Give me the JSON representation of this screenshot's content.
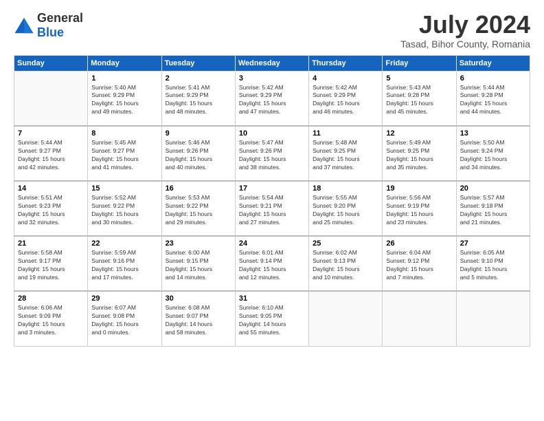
{
  "logo": {
    "general": "General",
    "blue": "Blue"
  },
  "title": {
    "month_year": "July 2024",
    "location": "Tasad, Bihor County, Romania"
  },
  "weekdays": [
    "Sunday",
    "Monday",
    "Tuesday",
    "Wednesday",
    "Thursday",
    "Friday",
    "Saturday"
  ],
  "weeks": [
    [
      {
        "day": "",
        "info": ""
      },
      {
        "day": "1",
        "info": "Sunrise: 5:40 AM\nSunset: 9:29 PM\nDaylight: 15 hours\nand 49 minutes."
      },
      {
        "day": "2",
        "info": "Sunrise: 5:41 AM\nSunset: 9:29 PM\nDaylight: 15 hours\nand 48 minutes."
      },
      {
        "day": "3",
        "info": "Sunrise: 5:42 AM\nSunset: 9:29 PM\nDaylight: 15 hours\nand 47 minutes."
      },
      {
        "day": "4",
        "info": "Sunrise: 5:42 AM\nSunset: 9:29 PM\nDaylight: 15 hours\nand 46 minutes."
      },
      {
        "day": "5",
        "info": "Sunrise: 5:43 AM\nSunset: 9:28 PM\nDaylight: 15 hours\nand 45 minutes."
      },
      {
        "day": "6",
        "info": "Sunrise: 5:44 AM\nSunset: 9:28 PM\nDaylight: 15 hours\nand 44 minutes."
      }
    ],
    [
      {
        "day": "7",
        "info": "Sunrise: 5:44 AM\nSunset: 9:27 PM\nDaylight: 15 hours\nand 42 minutes."
      },
      {
        "day": "8",
        "info": "Sunrise: 5:45 AM\nSunset: 9:27 PM\nDaylight: 15 hours\nand 41 minutes."
      },
      {
        "day": "9",
        "info": "Sunrise: 5:46 AM\nSunset: 9:26 PM\nDaylight: 15 hours\nand 40 minutes."
      },
      {
        "day": "10",
        "info": "Sunrise: 5:47 AM\nSunset: 9:26 PM\nDaylight: 15 hours\nand 38 minutes."
      },
      {
        "day": "11",
        "info": "Sunrise: 5:48 AM\nSunset: 9:25 PM\nDaylight: 15 hours\nand 37 minutes."
      },
      {
        "day": "12",
        "info": "Sunrise: 5:49 AM\nSunset: 9:25 PM\nDaylight: 15 hours\nand 35 minutes."
      },
      {
        "day": "13",
        "info": "Sunrise: 5:50 AM\nSunset: 9:24 PM\nDaylight: 15 hours\nand 34 minutes."
      }
    ],
    [
      {
        "day": "14",
        "info": "Sunrise: 5:51 AM\nSunset: 9:23 PM\nDaylight: 15 hours\nand 32 minutes."
      },
      {
        "day": "15",
        "info": "Sunrise: 5:52 AM\nSunset: 9:22 PM\nDaylight: 15 hours\nand 30 minutes."
      },
      {
        "day": "16",
        "info": "Sunrise: 5:53 AM\nSunset: 9:22 PM\nDaylight: 15 hours\nand 29 minutes."
      },
      {
        "day": "17",
        "info": "Sunrise: 5:54 AM\nSunset: 9:21 PM\nDaylight: 15 hours\nand 27 minutes."
      },
      {
        "day": "18",
        "info": "Sunrise: 5:55 AM\nSunset: 9:20 PM\nDaylight: 15 hours\nand 25 minutes."
      },
      {
        "day": "19",
        "info": "Sunrise: 5:56 AM\nSunset: 9:19 PM\nDaylight: 15 hours\nand 23 minutes."
      },
      {
        "day": "20",
        "info": "Sunrise: 5:57 AM\nSunset: 9:18 PM\nDaylight: 15 hours\nand 21 minutes."
      }
    ],
    [
      {
        "day": "21",
        "info": "Sunrise: 5:58 AM\nSunset: 9:17 PM\nDaylight: 15 hours\nand 19 minutes."
      },
      {
        "day": "22",
        "info": "Sunrise: 5:59 AM\nSunset: 9:16 PM\nDaylight: 15 hours\nand 17 minutes."
      },
      {
        "day": "23",
        "info": "Sunrise: 6:00 AM\nSunset: 9:15 PM\nDaylight: 15 hours\nand 14 minutes."
      },
      {
        "day": "24",
        "info": "Sunrise: 6:01 AM\nSunset: 9:14 PM\nDaylight: 15 hours\nand 12 minutes."
      },
      {
        "day": "25",
        "info": "Sunrise: 6:02 AM\nSunset: 9:13 PM\nDaylight: 15 hours\nand 10 minutes."
      },
      {
        "day": "26",
        "info": "Sunrise: 6:04 AM\nSunset: 9:12 PM\nDaylight: 15 hours\nand 7 minutes."
      },
      {
        "day": "27",
        "info": "Sunrise: 6:05 AM\nSunset: 9:10 PM\nDaylight: 15 hours\nand 5 minutes."
      }
    ],
    [
      {
        "day": "28",
        "info": "Sunrise: 6:06 AM\nSunset: 9:09 PM\nDaylight: 15 hours\nand 3 minutes."
      },
      {
        "day": "29",
        "info": "Sunrise: 6:07 AM\nSunset: 9:08 PM\nDaylight: 15 hours\nand 0 minutes."
      },
      {
        "day": "30",
        "info": "Sunrise: 6:08 AM\nSunset: 9:07 PM\nDaylight: 14 hours\nand 58 minutes."
      },
      {
        "day": "31",
        "info": "Sunrise: 6:10 AM\nSunset: 9:05 PM\nDaylight: 14 hours\nand 55 minutes."
      },
      {
        "day": "",
        "info": ""
      },
      {
        "day": "",
        "info": ""
      },
      {
        "day": "",
        "info": ""
      }
    ]
  ]
}
